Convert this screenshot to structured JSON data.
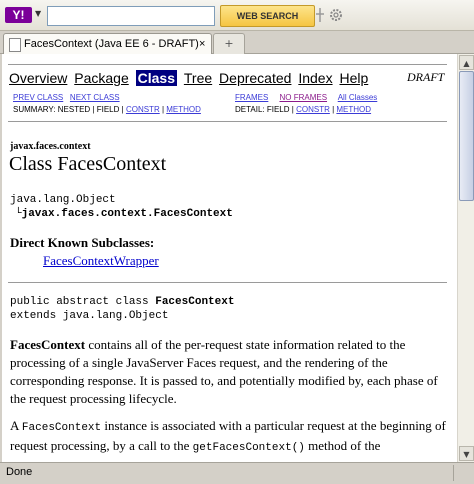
{
  "toolbar": {
    "logo": "Y!",
    "search_value": "",
    "web_search_label": "WEB SEARCH"
  },
  "tab": {
    "label": "FacesContext (Java EE 6 - DRAFT)",
    "close": "×",
    "new_tab": "+"
  },
  "navbar": {
    "items": [
      "Overview",
      "Package",
      "Class",
      "Tree",
      "Deprecated",
      "Index",
      "Help"
    ],
    "current": "Class",
    "draft": "DRAFT"
  },
  "subnav": {
    "prev_class": "PREV CLASS",
    "next_class": "NEXT CLASS",
    "frames": "FRAMES",
    "no_frames": "NO FRAMES",
    "all_classes": "All Classes",
    "summary_prefix": "SUMMARY: NESTED | FIELD |",
    "summary_constr": "CONSTR",
    "summary_method": "METHOD",
    "detail_prefix": "DETAIL: FIELD |",
    "detail_constr": "CONSTR",
    "detail_method": "METHOD"
  },
  "doc": {
    "package": "javax.faces.context",
    "class_title": "Class FacesContext",
    "superclass": "java.lang.Object",
    "class_full": "javax.faces.context.FacesContext",
    "known_subclasses_heading": "Direct Known Subclasses:",
    "known_subclass": "FacesContextWrapper",
    "declaration_prefix": "public abstract class ",
    "declaration_name": "FacesContext",
    "extends_line": "extends java.lang.Object",
    "para1_bold": "FacesContext",
    "para1_rest": " contains all of the per-request state information related to the processing of a single JavaServer Faces request, and the rendering of the corresponding response. It is passed to, and potentially modified by, each phase of the request processing lifecycle.",
    "para2_a": "A ",
    "para2_code1": "FacesContext",
    "para2_b": " instance is associated with a particular request at the beginning of request processing, by a call to the ",
    "para2_code2": "getFacesContext()",
    "para2_c": " method of the"
  },
  "status": {
    "text": "Done"
  },
  "colors": {
    "nav_current_bg": "#000080",
    "link": "#0000cc",
    "yahoo_purple": "#7b0099"
  }
}
